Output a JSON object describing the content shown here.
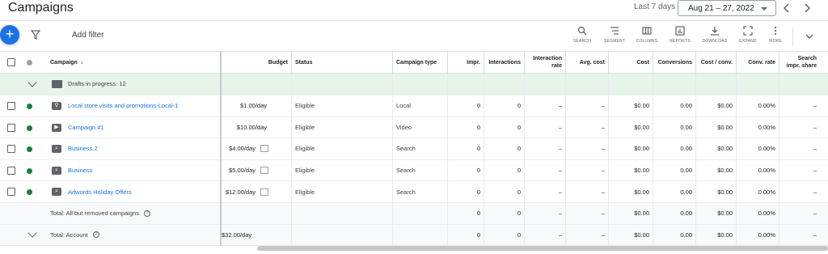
{
  "header": {
    "title": "Campaigns",
    "range_label": "Last 7 days",
    "date_range": "Aug 21 – 27, 2022"
  },
  "toolbar": {
    "add_filter": "Add filter",
    "tools": [
      {
        "label": "SEARCH",
        "icon": "search-icon"
      },
      {
        "label": "SEGMENT",
        "icon": "segment-icon"
      },
      {
        "label": "COLUMNS",
        "icon": "columns-icon"
      },
      {
        "label": "REPORTS",
        "icon": "reports-icon"
      },
      {
        "label": "DOWNLOAD",
        "icon": "download-icon"
      },
      {
        "label": "EXPAND",
        "icon": "expand-icon"
      },
      {
        "label": "MORE",
        "icon": "more-icon"
      }
    ]
  },
  "table": {
    "columns": [
      "Campaign",
      "Budget",
      "Status",
      "Campaign type",
      "Impr.",
      "Interactions",
      "Interaction rate",
      "Avg. cost",
      "Cost",
      "Conversions",
      "Cost / conv.",
      "Conv. rate",
      "Search impr. share"
    ],
    "drafts_label": "Drafts in progress: 12",
    "rows": [
      {
        "name": "Local store visits and promotions-Local-1",
        "icon": "location-icon",
        "budget": "$1.00/day",
        "status": "Eligible",
        "type": "Local",
        "impr": "0",
        "interactions": "0",
        "interaction_rate": "–",
        "avg_cost": "–",
        "cost": "$0.00",
        "conversions": "0.00",
        "cost_conv": "$0.00",
        "conv_rate": "0.00%",
        "search_share": "–"
      },
      {
        "name": "Campaign #1",
        "icon": "video-icon",
        "budget": "$10.00/day",
        "status": "Eligible",
        "type": "Video",
        "impr": "0",
        "interactions": "0",
        "interaction_rate": "–",
        "avg_cost": "–",
        "cost": "$0.00",
        "conversions": "0.00",
        "cost_conv": "$0.00",
        "conv_rate": "0.00%",
        "search_share": "–"
      },
      {
        "name": "Business 2",
        "icon": "search-campaign-icon",
        "budget": "$4.00/day",
        "status": "Eligible",
        "type": "Search",
        "impr": "0",
        "interactions": "0",
        "interaction_rate": "–",
        "avg_cost": "–",
        "cost": "$0.00",
        "conversions": "0.00",
        "cost_conv": "$0.00",
        "conv_rate": "0.00%",
        "search_share": "–"
      },
      {
        "name": "Business",
        "icon": "search-campaign-icon",
        "budget": "$5.00/day",
        "status": "Eligible",
        "type": "Search",
        "impr": "0",
        "interactions": "0",
        "interaction_rate": "–",
        "avg_cost": "–",
        "cost": "$0.00",
        "conversions": "0.00",
        "cost_conv": "$0.00",
        "conv_rate": "0.00%",
        "search_share": "–"
      },
      {
        "name": "Adwords Holiday Offers",
        "icon": "search-campaign-icon",
        "budget": "$12.00/day",
        "status": "Eligible",
        "type": "Search",
        "impr": "0",
        "interactions": "0",
        "interaction_rate": "–",
        "avg_cost": "–",
        "cost": "$0.00",
        "conversions": "0.00",
        "cost_conv": "$0.00",
        "conv_rate": "0.00%",
        "search_share": "–"
      }
    ],
    "totals": [
      {
        "label": "Total: All but removed campaigns",
        "budget": "",
        "impr": "0",
        "interactions": "0",
        "interaction_rate": "–",
        "avg_cost": "–",
        "cost": "$0.00",
        "conversions": "0.00",
        "cost_conv": "$0.00",
        "conv_rate": "0.00%",
        "search_share": "–"
      },
      {
        "label": "Total: Account",
        "budget": "$32.00/day",
        "impr": "0",
        "interactions": "0",
        "interaction_rate": "–",
        "avg_cost": "–",
        "cost": "$0.00",
        "conversions": "0.00",
        "cost_conv": "$0.00",
        "conv_rate": "0.00%",
        "search_share": "–"
      }
    ]
  },
  "colors": {
    "accent": "#1a73e8",
    "enabled_dot": "#188038",
    "drafts_bg": "#e6f4ea",
    "totals_bg": "#f8f9fa"
  }
}
